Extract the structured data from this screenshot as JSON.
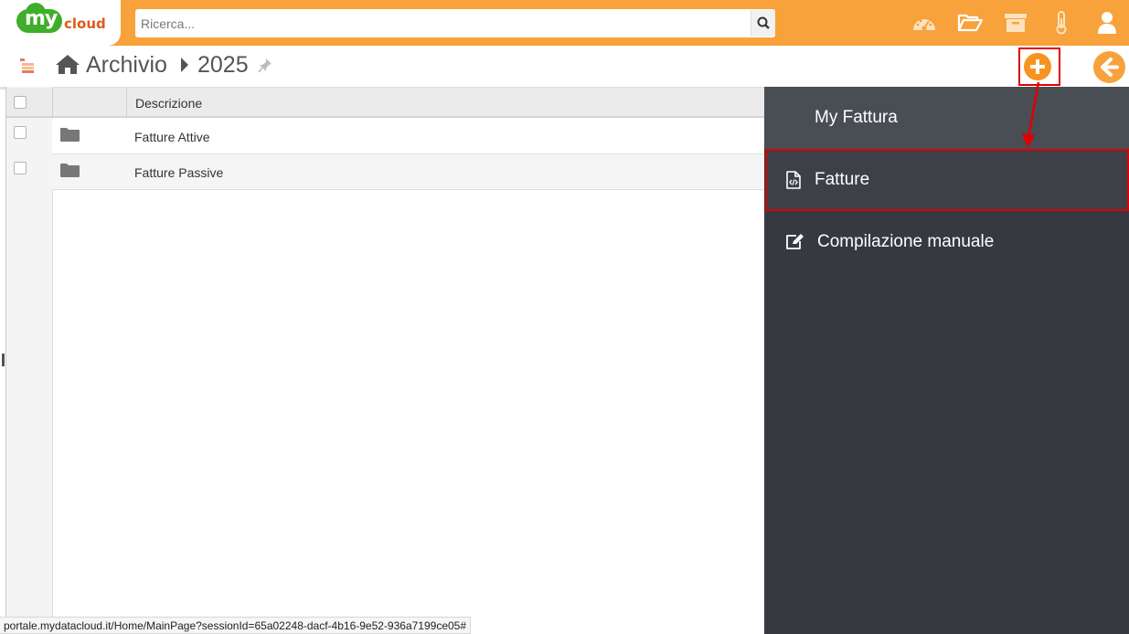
{
  "header": {
    "logo_my": "my",
    "logo_cloud": "cloud",
    "search": {
      "placeholder": "Ricerca..."
    },
    "icons": [
      "dashboard-icon",
      "folder-open-icon",
      "archive-icon",
      "thermometer-icon",
      "user-icon"
    ]
  },
  "breadcrumb": {
    "root": "Archivio",
    "current": "2025"
  },
  "table": {
    "columns": [
      "",
      "",
      "Descrizione"
    ],
    "rows": [
      {
        "icon": "folder-icon",
        "label": "Fatture Attive"
      },
      {
        "icon": "folder-icon",
        "label": "Fatture Passive"
      }
    ]
  },
  "panel": {
    "title": "My Fattura",
    "items": [
      {
        "icon": "file-code-icon",
        "label": "Fatture",
        "highlighted": true
      },
      {
        "icon": "edit-icon",
        "label": "Compilazione manuale",
        "highlighted": false
      }
    ]
  },
  "status_bar": {
    "url": "portale.mydatacloud.it/Home/MainPage?sessionId=65a02248-dacf-4b16-9e52-936a7199ce05#"
  },
  "colors": {
    "accent": "#f7a23b",
    "add_button": "#f7931e",
    "panel_bg": "#36393f",
    "panel_header": "#494d54",
    "highlight": "#e00000",
    "logo_green": "#3fae2a"
  }
}
